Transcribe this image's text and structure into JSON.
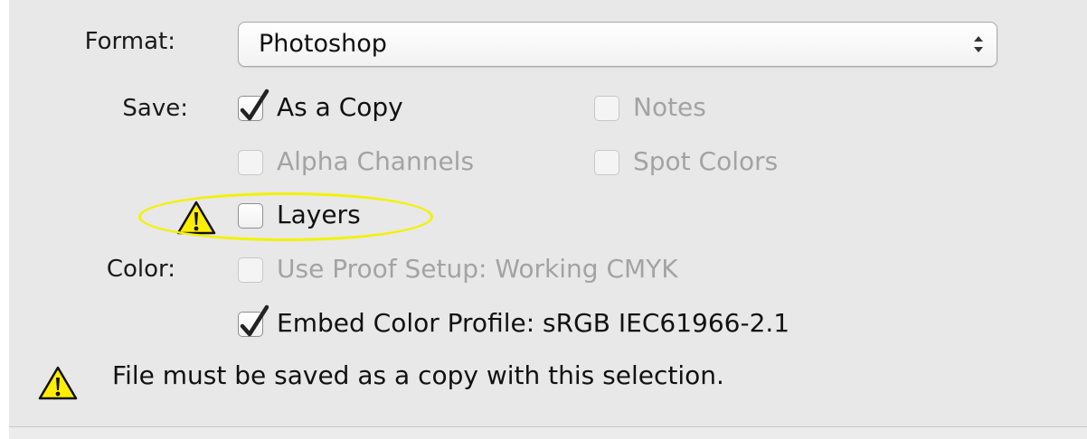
{
  "save_options": {
    "format": {
      "label": "Format:",
      "selected": "Photoshop"
    },
    "save": {
      "label": "Save:",
      "as_a_copy": {
        "label": "As a Copy",
        "checked": true,
        "enabled": true
      },
      "notes": {
        "label": "Notes",
        "checked": false,
        "enabled": false
      },
      "alpha_channels": {
        "label": "Alpha Channels",
        "checked": false,
        "enabled": false
      },
      "spot_colors": {
        "label": "Spot Colors",
        "checked": false,
        "enabled": false
      },
      "layers": {
        "label": "Layers",
        "checked": false,
        "enabled": true,
        "warning_icon": "warning-triangle-icon"
      }
    },
    "color": {
      "label": "Color:",
      "use_proof_setup": {
        "label": "Use Proof Setup:  Working CMYK",
        "checked": false,
        "enabled": false
      },
      "embed_color_profile": {
        "label": "Embed Color Profile:  sRGB IEC61966-2.1",
        "checked": true,
        "enabled": true
      }
    },
    "warning": {
      "icon": "warning-triangle-icon",
      "message": "File must be saved as a copy with this selection."
    }
  },
  "colors": {
    "panel_background": "#e8e8e8",
    "highlight_ellipse": "#f2f200",
    "warning_fill": "#ffee00",
    "disabled_text": "#a3a3a3"
  }
}
